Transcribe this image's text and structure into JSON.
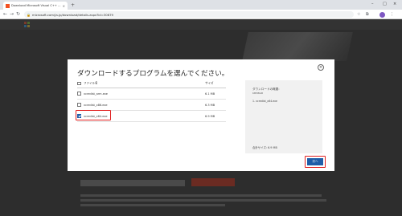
{
  "browser": {
    "tab_title": "Download Microsoft Visual C++ ...",
    "tab_close": "×",
    "new_tab": "+",
    "url": "microsoft.com/ja-jp/download/details.aspx?id=30679",
    "window_controls": [
      "–",
      "□",
      "×"
    ],
    "nav": {
      "back": "←",
      "forward": "→",
      "reload": "↻"
    }
  },
  "modal": {
    "title": "ダウンロードするプログラムを選んでください。",
    "close_glyph": "×",
    "table": {
      "header_name": "ファイル名",
      "header_size": "サイズ",
      "rows": [
        {
          "name": "vcredist_arm.exe",
          "size": "6.1 MB",
          "checked": false
        },
        {
          "name": "vcredist_x86.exe",
          "size": "6.3 MB",
          "checked": false
        },
        {
          "name": "vcredist_x64.exe",
          "size": "6.9 MB",
          "checked": true
        }
      ]
    },
    "summary": {
      "title": "ダウンロードの概要:",
      "subtitle": "KBMBGB",
      "items": [
        "1.  vcredist_x64.exe"
      ],
      "total": "合計サイズ: 6.9 MB"
    },
    "next_label": "次へ"
  }
}
